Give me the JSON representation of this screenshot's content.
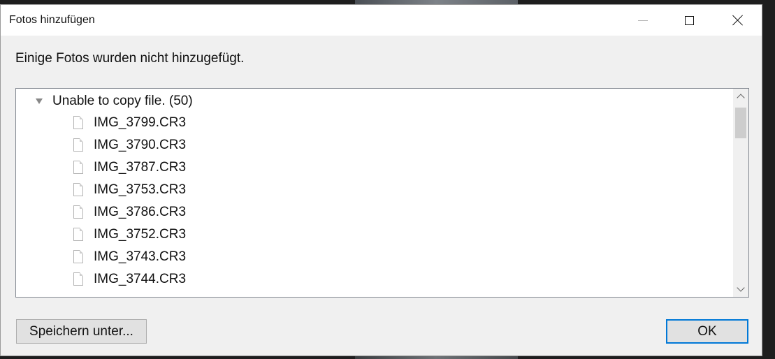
{
  "window": {
    "title": "Fotos hinzufügen",
    "controls": {
      "minimize_icon": "minimize-icon",
      "maximize_icon": "maximize-icon",
      "close_icon": "close-icon"
    }
  },
  "message": "Einige Fotos wurden nicht hinzugefügt.",
  "group": {
    "label": "Unable to copy file. (50)",
    "expanded": true,
    "files": [
      "IMG_3799.CR3",
      "IMG_3790.CR3",
      "IMG_3787.CR3",
      "IMG_3753.CR3",
      "IMG_3786.CR3",
      "IMG_3752.CR3",
      "IMG_3743.CR3",
      "IMG_3744.CR3"
    ]
  },
  "buttons": {
    "save_as": "Speichern unter...",
    "ok": "OK"
  },
  "colors": {
    "dialog_bg": "#f0f0f0",
    "titlebar_bg": "#ffffff",
    "focus_border": "#0078d7"
  }
}
